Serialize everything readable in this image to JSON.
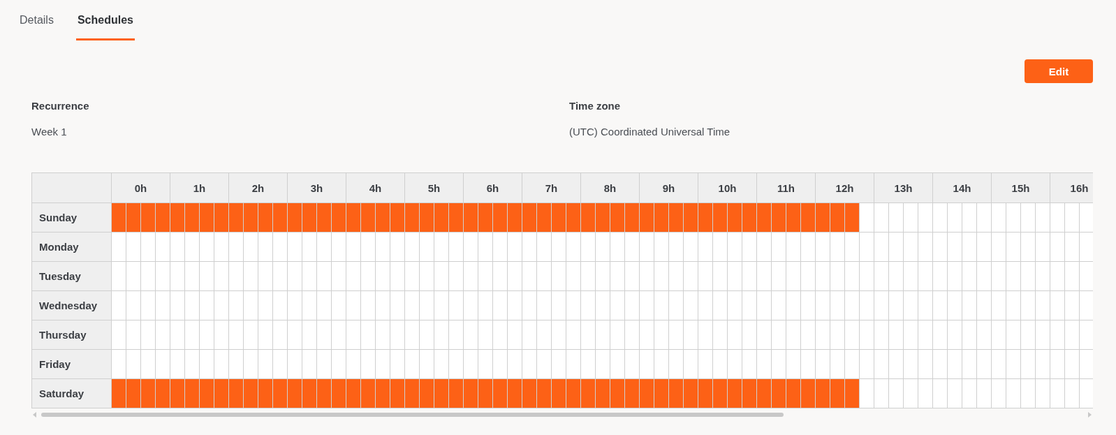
{
  "tabs": [
    {
      "label": "Details",
      "selected": false
    },
    {
      "label": "Schedules",
      "selected": true
    }
  ],
  "edit_button": "Edit",
  "fields": [
    {
      "label": "Recurrence",
      "value": "Week 1"
    },
    {
      "label": "Time zone",
      "value": "(UTC) Coordinated Universal Time"
    }
  ],
  "schedule": {
    "hours": [
      "0h",
      "1h",
      "2h",
      "3h",
      "4h",
      "5h",
      "6h",
      "7h",
      "8h",
      "9h",
      "10h",
      "11h",
      "12h",
      "13h",
      "14h",
      "15h",
      "16h"
    ],
    "days": [
      {
        "name": "Sunday",
        "slots": [
          true,
          true,
          true,
          true,
          true,
          true,
          true,
          true,
          true,
          true,
          true,
          true,
          true,
          true,
          true,
          true,
          true,
          true,
          true,
          true,
          true,
          true,
          true,
          true,
          true,
          true,
          true,
          true,
          true,
          true,
          true,
          true,
          true,
          true,
          true,
          true,
          true,
          true,
          true,
          true,
          true,
          true,
          true,
          true,
          true,
          true,
          true,
          true,
          true,
          true,
          true,
          false,
          false,
          false,
          false,
          false,
          false,
          false,
          false,
          false,
          false,
          false,
          false,
          false,
          false,
          false,
          false
        ]
      },
      {
        "name": "Monday",
        "slots": [
          false,
          false,
          false,
          false,
          false,
          false,
          false,
          false,
          false,
          false,
          false,
          false,
          false,
          false,
          false,
          false,
          false,
          false,
          false,
          false,
          false,
          false,
          false,
          false,
          false,
          false,
          false,
          false,
          false,
          false,
          false,
          false,
          false,
          false,
          false,
          false,
          false,
          false,
          false,
          false,
          false,
          false,
          false,
          false,
          false,
          false,
          false,
          false,
          false,
          false,
          false,
          false,
          false,
          false,
          false,
          false,
          false,
          false,
          false,
          false,
          false,
          false,
          false,
          false,
          false,
          false,
          false
        ]
      },
      {
        "name": "Tuesday",
        "slots": [
          false,
          false,
          false,
          false,
          false,
          false,
          false,
          false,
          false,
          false,
          false,
          false,
          false,
          false,
          false,
          false,
          false,
          false,
          false,
          false,
          false,
          false,
          false,
          false,
          false,
          false,
          false,
          false,
          false,
          false,
          false,
          false,
          false,
          false,
          false,
          false,
          false,
          false,
          false,
          false,
          false,
          false,
          false,
          false,
          false,
          false,
          false,
          false,
          false,
          false,
          false,
          false,
          false,
          false,
          false,
          false,
          false,
          false,
          false,
          false,
          false,
          false,
          false,
          false,
          false,
          false,
          false
        ]
      },
      {
        "name": "Wednesday",
        "slots": [
          false,
          false,
          false,
          false,
          false,
          false,
          false,
          false,
          false,
          false,
          false,
          false,
          false,
          false,
          false,
          false,
          false,
          false,
          false,
          false,
          false,
          false,
          false,
          false,
          false,
          false,
          false,
          false,
          false,
          false,
          false,
          false,
          false,
          false,
          false,
          false,
          false,
          false,
          false,
          false,
          false,
          false,
          false,
          false,
          false,
          false,
          false,
          false,
          false,
          false,
          false,
          false,
          false,
          false,
          false,
          false,
          false,
          false,
          false,
          false,
          false,
          false,
          false,
          false,
          false,
          false,
          false
        ]
      },
      {
        "name": "Thursday",
        "slots": [
          false,
          false,
          false,
          false,
          false,
          false,
          false,
          false,
          false,
          false,
          false,
          false,
          false,
          false,
          false,
          false,
          false,
          false,
          false,
          false,
          false,
          false,
          false,
          false,
          false,
          false,
          false,
          false,
          false,
          false,
          false,
          false,
          false,
          false,
          false,
          false,
          false,
          false,
          false,
          false,
          false,
          false,
          false,
          false,
          false,
          false,
          false,
          false,
          false,
          false,
          false,
          false,
          false,
          false,
          false,
          false,
          false,
          false,
          false,
          false,
          false,
          false,
          false,
          false,
          false,
          false,
          false
        ]
      },
      {
        "name": "Friday",
        "slots": [
          false,
          false,
          false,
          false,
          false,
          false,
          false,
          false,
          false,
          false,
          false,
          false,
          false,
          false,
          false,
          false,
          false,
          false,
          false,
          false,
          false,
          false,
          false,
          false,
          false,
          false,
          false,
          false,
          false,
          false,
          false,
          false,
          false,
          false,
          false,
          false,
          false,
          false,
          false,
          false,
          false,
          false,
          false,
          false,
          false,
          false,
          false,
          false,
          false,
          false,
          false,
          false,
          false,
          false,
          false,
          false,
          false,
          false,
          false,
          false,
          false,
          false,
          false,
          false,
          false,
          false,
          false
        ]
      },
      {
        "name": "Saturday",
        "slots": [
          true,
          true,
          true,
          true,
          true,
          true,
          true,
          true,
          true,
          true,
          true,
          true,
          true,
          true,
          true,
          true,
          true,
          true,
          true,
          true,
          true,
          true,
          true,
          true,
          true,
          true,
          true,
          true,
          true,
          true,
          true,
          true,
          true,
          true,
          true,
          true,
          true,
          true,
          true,
          true,
          true,
          true,
          true,
          true,
          true,
          true,
          true,
          true,
          true,
          true,
          true,
          false,
          false,
          false,
          false,
          false,
          false,
          false,
          false,
          false,
          false,
          false,
          false,
          false,
          false,
          false,
          false
        ]
      }
    ]
  }
}
